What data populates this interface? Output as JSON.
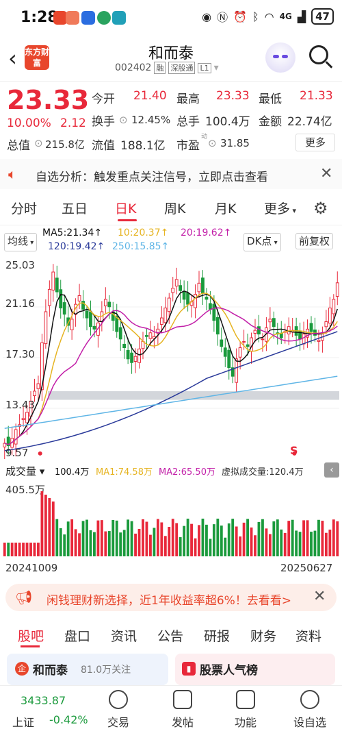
{
  "status_bar": {
    "time": "1:28",
    "battery": "47",
    "network": "4G"
  },
  "header": {
    "stock_name": "和而泰",
    "stock_code": "002402",
    "tags": [
      "融",
      "深股通",
      "L1"
    ],
    "logo_text": "东方财富"
  },
  "quote": {
    "price": "23.33",
    "change_pct": "10.00%",
    "change": "2.12",
    "open_label": "今开",
    "open": "21.40",
    "high_label": "最高",
    "high": "23.33",
    "low_label": "最低",
    "low": "21.33",
    "turnover_rate_label": "换手",
    "turnover_rate": "12.45%",
    "volume_label": "总手",
    "volume": "100.4万",
    "amount_label": "金额",
    "amount": "22.74亿",
    "market_cap_label": "总值",
    "market_cap": "215.8亿",
    "float_cap_label": "流值",
    "float_cap": "188.1亿",
    "pe_label": "市盈",
    "pe_sup": "动",
    "pe": "31.85",
    "more_label": "更多"
  },
  "notice": {
    "text": "自选分析：触发重点关注信号，立即点击查看"
  },
  "period_tabs": [
    "分时",
    "五日",
    "日K",
    "周K",
    "月K",
    "更多"
  ],
  "period_active": "日K",
  "indicators": {
    "ma_label": "均线",
    "ma5": "MA5:21.34↑",
    "ma10": "10:20.37↑",
    "ma20": "20:19.62↑",
    "ma120": "120:19.42↑",
    "ma250": "250:15.85↑",
    "dk_label": "DK点",
    "adjust_label": "前复权"
  },
  "chart_y_labels": [
    "25.03",
    "21.16",
    "17.30",
    "13.43",
    "9.57"
  ],
  "volume_panel": {
    "label": "成交量",
    "vol": "100.4万",
    "ma1": "MA1:74.58万",
    "ma2": "MA2:65.50万",
    "virtual": "虚拟成交量:120.4万",
    "max_label": "405.5万"
  },
  "date_range": {
    "start": "20241009",
    "end": "20250627"
  },
  "signal_label": "S",
  "banner": {
    "text": "闲钱理财新选择，近1年收益率超6%！去看看>"
  },
  "bottom_tabs": [
    "股吧",
    "盘口",
    "资讯",
    "公告",
    "研报",
    "财务",
    "资料"
  ],
  "bottom_active": "股吧",
  "cards": {
    "left_title": "和而泰",
    "left_sub": "81.0万关注",
    "right_title": "股票人气榜"
  },
  "footer": {
    "index_name": "上证",
    "index_value": "3433.87",
    "index_change": "-0.42%",
    "items": [
      "交易",
      "发帖",
      "功能",
      "设自选"
    ]
  },
  "colors": {
    "up": "#e8283a",
    "down": "#1a9a3c",
    "ma5": "#111111",
    "ma10": "#e6b422",
    "ma20": "#c21fa8",
    "ma120": "#2a3a9a",
    "ma250": "#5fb5e6"
  },
  "chart_data": {
    "type": "candlestick",
    "ylim": [
      9.57,
      25.03
    ],
    "close": [
      10.4,
      10.2,
      10.8,
      11.5,
      11.9,
      12.4,
      12.9,
      13.8,
      14.6,
      15.2,
      18.5,
      21.0,
      22.8,
      24.2,
      22.6,
      21.3,
      20.8,
      19.9,
      20.4,
      21.6,
      22.3,
      21.2,
      20.5,
      19.8,
      19.6,
      20.1,
      21.0,
      22.0,
      21.4,
      20.3,
      19.4,
      18.8,
      18.1,
      17.2,
      16.9,
      17.4,
      18.0,
      18.6,
      19.0,
      19.3,
      19.0,
      19.6,
      20.5,
      21.3,
      22.1,
      22.9,
      23.6,
      22.7,
      22.0,
      21.6,
      21.8,
      22.4,
      23.3,
      22.5,
      22.0,
      21.2,
      20.3,
      19.2,
      18.2,
      17.4,
      16.5,
      15.8,
      17.2,
      18.1,
      18.6,
      18.2,
      18.9,
      19.5,
      19.2,
      18.8,
      19.7,
      20.4,
      19.8,
      19.2,
      18.9,
      19.4,
      19.8,
      19.5,
      19.1,
      18.8,
      19.2,
      19.6,
      19.4,
      19.1,
      18.7,
      19.3,
      20.2,
      21.3,
      22.0,
      23.33
    ]
  }
}
